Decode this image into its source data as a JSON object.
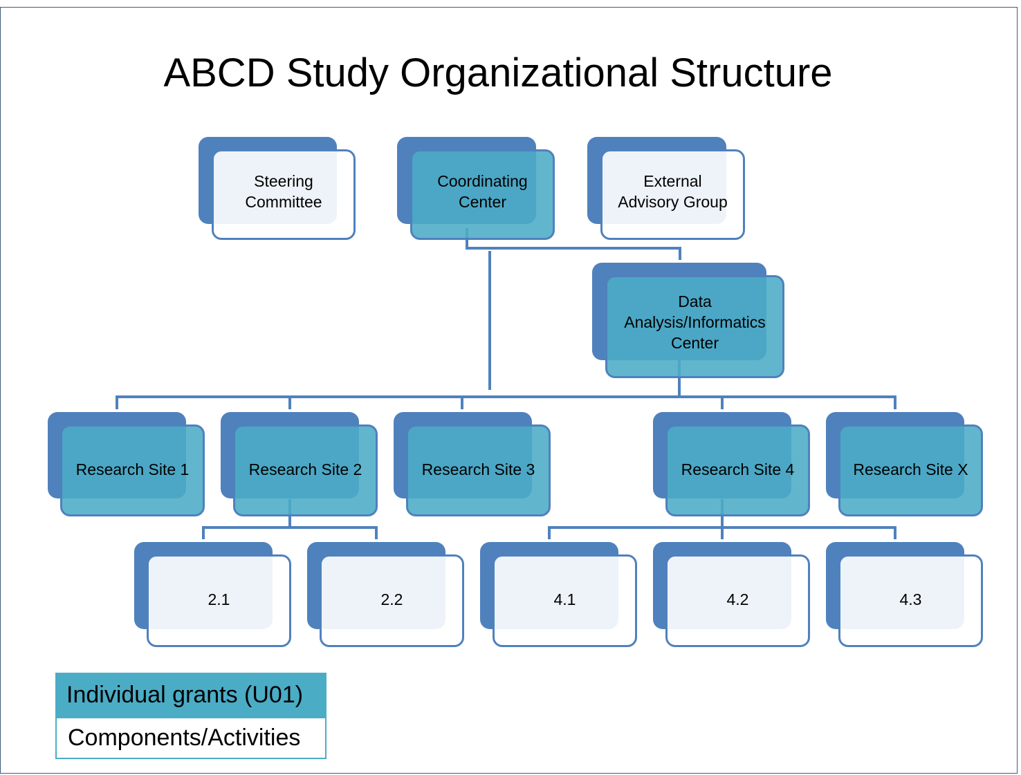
{
  "title": "ABCD Study Organizational Structure",
  "colors": {
    "back_box": "#4f81bd",
    "grant_fill": "#4bacc6",
    "component_fill": "#ffffff",
    "connector": "#4f81bd"
  },
  "nodes": {
    "steering": {
      "label": "Steering\nCommittee",
      "type": "committee"
    },
    "coordinating": {
      "label": "Coordinating\nCenter",
      "type": "grant"
    },
    "external": {
      "label": "External\nAdvisory Group",
      "type": "committee"
    },
    "daic": {
      "label": "Data\nAnalysis/Informatics\nCenter",
      "type": "grant"
    },
    "site1": {
      "label": "Research Site 1",
      "type": "grant"
    },
    "site2": {
      "label": "Research Site 2",
      "type": "grant"
    },
    "site3": {
      "label": "Research Site 3",
      "type": "grant"
    },
    "site4": {
      "label": "Research Site 4",
      "type": "grant"
    },
    "siteX": {
      "label": "Research Site X",
      "type": "grant"
    },
    "c21": {
      "label": "2.1",
      "type": "component"
    },
    "c22": {
      "label": "2.2",
      "type": "component"
    },
    "c41": {
      "label": "4.1",
      "type": "component"
    },
    "c42": {
      "label": "4.2",
      "type": "component"
    },
    "c43": {
      "label": "4.3",
      "type": "component"
    }
  },
  "edges": [
    [
      "coordinating",
      "daic"
    ],
    [
      "coordinating",
      "sites"
    ],
    [
      "daic",
      "sites"
    ],
    [
      "site2",
      "c21"
    ],
    [
      "site2",
      "c22"
    ],
    [
      "site4",
      "c41"
    ],
    [
      "site4",
      "c42"
    ],
    [
      "site4",
      "c43"
    ]
  ],
  "legend": {
    "grants": "Individual grants (U01)",
    "components": "Components/Activities"
  }
}
